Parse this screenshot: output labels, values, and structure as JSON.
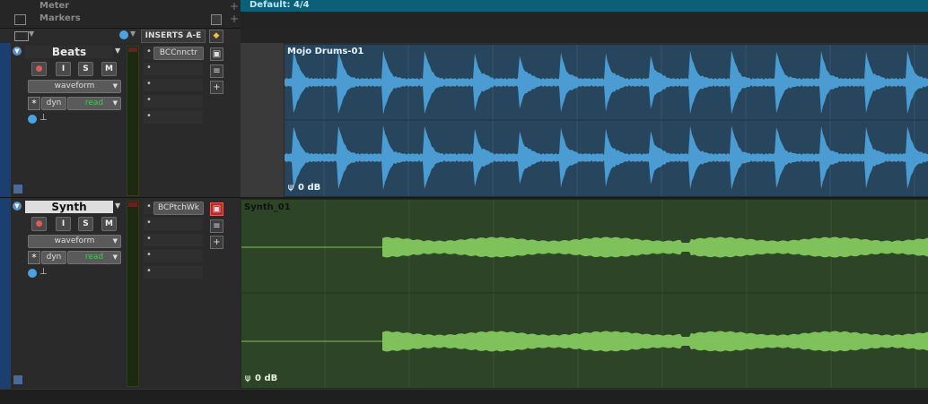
{
  "ruler": {
    "meter_label": "Meter",
    "markers_label": "Markers",
    "plus": "+",
    "tempo_text": "Default: 4/4"
  },
  "header_bar": {
    "inserts_label": "INSERTS A-E"
  },
  "tracks": [
    {
      "name": "Beats",
      "record": "●",
      "input": "I",
      "solo": "S",
      "mute": "M",
      "view_mode": "waveform",
      "automation_mode": "dyn",
      "automation_state": "read",
      "insert_plugin": "BCCnnctr",
      "insert_slots": [
        "•",
        "•",
        "•",
        "•"
      ],
      "clip_name": "Mojo Drums-01",
      "clip_gain": "0 dB",
      "color": "#4a9cd2",
      "clip_bg": "#27455c"
    },
    {
      "name": "Synth",
      "record": "●",
      "input": "I",
      "solo": "S",
      "mute": "M",
      "view_mode": "waveform",
      "automation_mode": "dyn",
      "automation_state": "read",
      "insert_plugin": "BCPtchWk",
      "insert_slots": [
        "•",
        "•",
        "•",
        "•"
      ],
      "clip_name": "Synth_01",
      "clip_gain": "0 dB",
      "color": "#7fc25c",
      "clip_bg": "#2e4427"
    }
  ]
}
